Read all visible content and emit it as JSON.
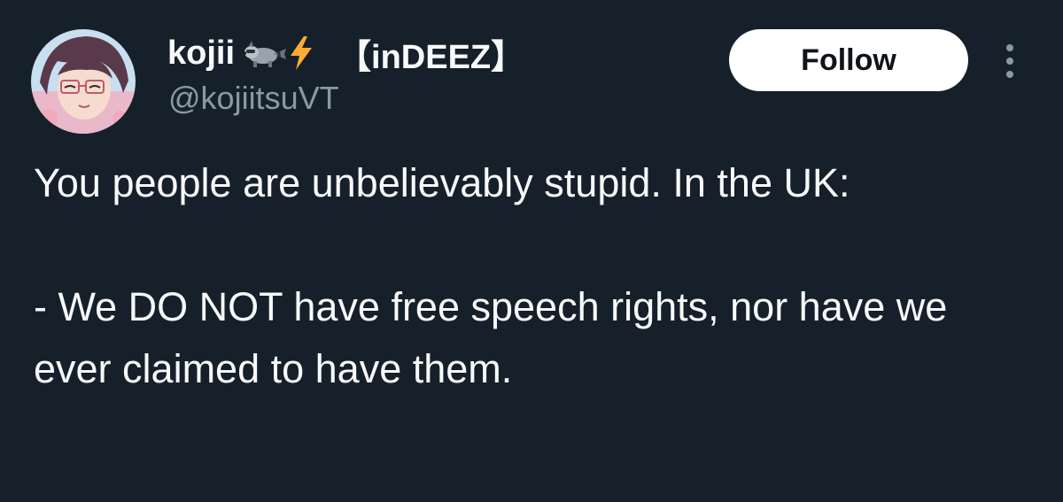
{
  "tweet": {
    "author": {
      "display_name": "kojii",
      "name_tag": "【inDEEZ】",
      "handle": "@kojiitsuVT",
      "avatar_icon": "anime-avatar-icon",
      "name_icons": [
        "raccoon-emoji-icon",
        "lightning-emoji-icon"
      ]
    },
    "actions": {
      "follow_label": "Follow",
      "more_icon": "more-vertical-icon"
    },
    "body": {
      "paragraphs": [
        "You people are unbelievably stupid. In the UK:",
        "- We DO NOT have free speech rights, nor have we ever claimed to have them."
      ]
    }
  },
  "colors": {
    "background": "#16202b",
    "text_primary": "#f7f9f9",
    "text_secondary": "#8b98a5",
    "follow_bg": "#ffffff",
    "follow_text": "#0f1419",
    "lightning": "#ffac33"
  }
}
